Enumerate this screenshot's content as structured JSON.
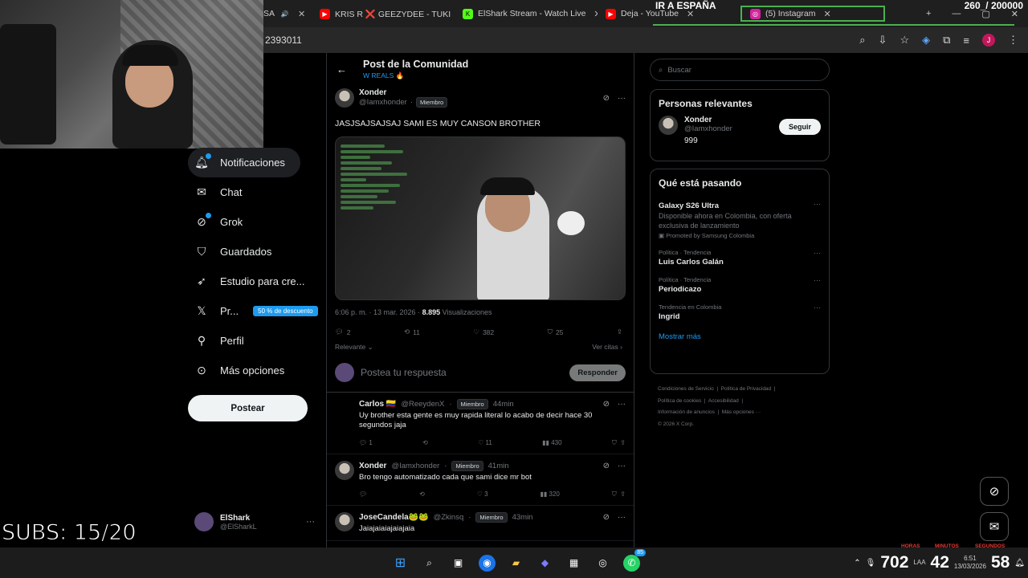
{
  "browser": {
    "tabs": [
      {
        "label": "SA"
      },
      {
        "label": "KRIS R ❌ GEEZYDEE - TUKI"
      },
      {
        "label": "ElShark Stream - Watch Live"
      },
      {
        "label": "Deja - YouTube"
      },
      {
        "label": "(5) Instagram"
      }
    ],
    "url": "2393011"
  },
  "overlay": {
    "title": "IR A ESPAÑA",
    "counter": "260_/ 200000",
    "subs": "SUBS: 15/20"
  },
  "sidebar": {
    "items": [
      {
        "label": "Notificaciones",
        "icon": "bell-icon"
      },
      {
        "label": "Chat",
        "icon": "mail-icon"
      },
      {
        "label": "Grok",
        "icon": "grok-icon"
      },
      {
        "label": "Guardados",
        "icon": "bookmark-icon"
      },
      {
        "label": "Estudio para cre...",
        "icon": "rocket-icon"
      },
      {
        "label": "Pr...",
        "icon": "x-logo-icon",
        "promo": "50 % de descuento"
      },
      {
        "label": "Perfil",
        "icon": "person-icon"
      },
      {
        "label": "Más opciones",
        "icon": "more-circle-icon"
      }
    ],
    "post_button": "Postear",
    "account": {
      "name": "ElShark",
      "handle": "@ElSharkL"
    }
  },
  "main": {
    "header_title": "Post de la Comunidad",
    "header_subtitle": "W REALS 🔥",
    "post": {
      "author": "Xonder",
      "handle": "@Iamxhonder",
      "badge": "Miembro",
      "text": "JASJSAJSAJSAJ SAMI ES MUY CANSON BROTHER",
      "time": "6:06 p. m. · 13 mar. 2026 ·",
      "views": "8.895",
      "views_label": "Visualizaciones",
      "replies": "2",
      "reposts": "11",
      "likes": "382",
      "bookmarks": "25"
    },
    "sort_label": "Relevante",
    "quotes_label": "Ver citas",
    "reply_placeholder": "Postea tu respuesta",
    "reply_button": "Responder",
    "replies": [
      {
        "author": "Carlos 🇨🇴",
        "handle": "@ReeydenX",
        "badge": "Miembro",
        "time": "44min",
        "text": "Uy brother esta gente es muy rapida literal lo acabo de decir hace 30 segundos jaja",
        "replies": "1",
        "likes": "11",
        "views": "430"
      },
      {
        "author": "Xonder",
        "handle": "@Iamxhonder",
        "badge": "Miembro",
        "time": "41min",
        "text": "Bro tengo automatizado cada que sami dice mr bot",
        "replies": "",
        "likes": "3",
        "views": "320"
      },
      {
        "author": "JoseCandela🐸🐸",
        "handle": "@Zkinsq",
        "badge": "Miembro",
        "time": "43min",
        "text": "Jaiajaiaiajaiajaia",
        "replies": "",
        "likes": "",
        "views": ""
      }
    ]
  },
  "right": {
    "search_placeholder": "Buscar",
    "relevant_title": "Personas relevantes",
    "relevant": {
      "name": "Xonder",
      "handle": "@Iamxhonder",
      "bio": "999",
      "follow": "Seguir"
    },
    "trends_title": "Qué está pasando",
    "trends": [
      {
        "cat": "",
        "name": "Galaxy S26 Ultra",
        "desc": "Disponible ahora en Colombia, con oferta exclusiva de lanzamiento",
        "promo": "Promoted by Samsung Colombia"
      },
      {
        "cat": "Política · Tendencia",
        "name": "Luis Carlos Galán",
        "desc": "",
        "promo": ""
      },
      {
        "cat": "Política · Tendencia",
        "name": "Periodicazo",
        "desc": "",
        "promo": ""
      },
      {
        "cat": "Tendencia en Colombia",
        "name": "Ingrid",
        "desc": "",
        "promo": ""
      }
    ],
    "show_more": "Mostrar más",
    "footer": [
      "Condiciones de Servicio",
      "Política de Privacidad",
      "Política de cookies",
      "Accesibilidad",
      "Información de anuncios",
      "Más opciones ···",
      "© 2026 X Corp."
    ]
  },
  "taskbar": {
    "whatsapp_badge": "85",
    "tray_left": "702",
    "tray_mid": "42",
    "tray_right": "58",
    "time": "6:51",
    "date": "13/03/2026",
    "lang": "LAA",
    "labels": [
      "HORAS",
      "MINUTOS",
      "SEGUNDOS"
    ]
  },
  "colors": {
    "accent": "#1d9bf0",
    "border": "#2f3336",
    "muted": "#71767b"
  }
}
